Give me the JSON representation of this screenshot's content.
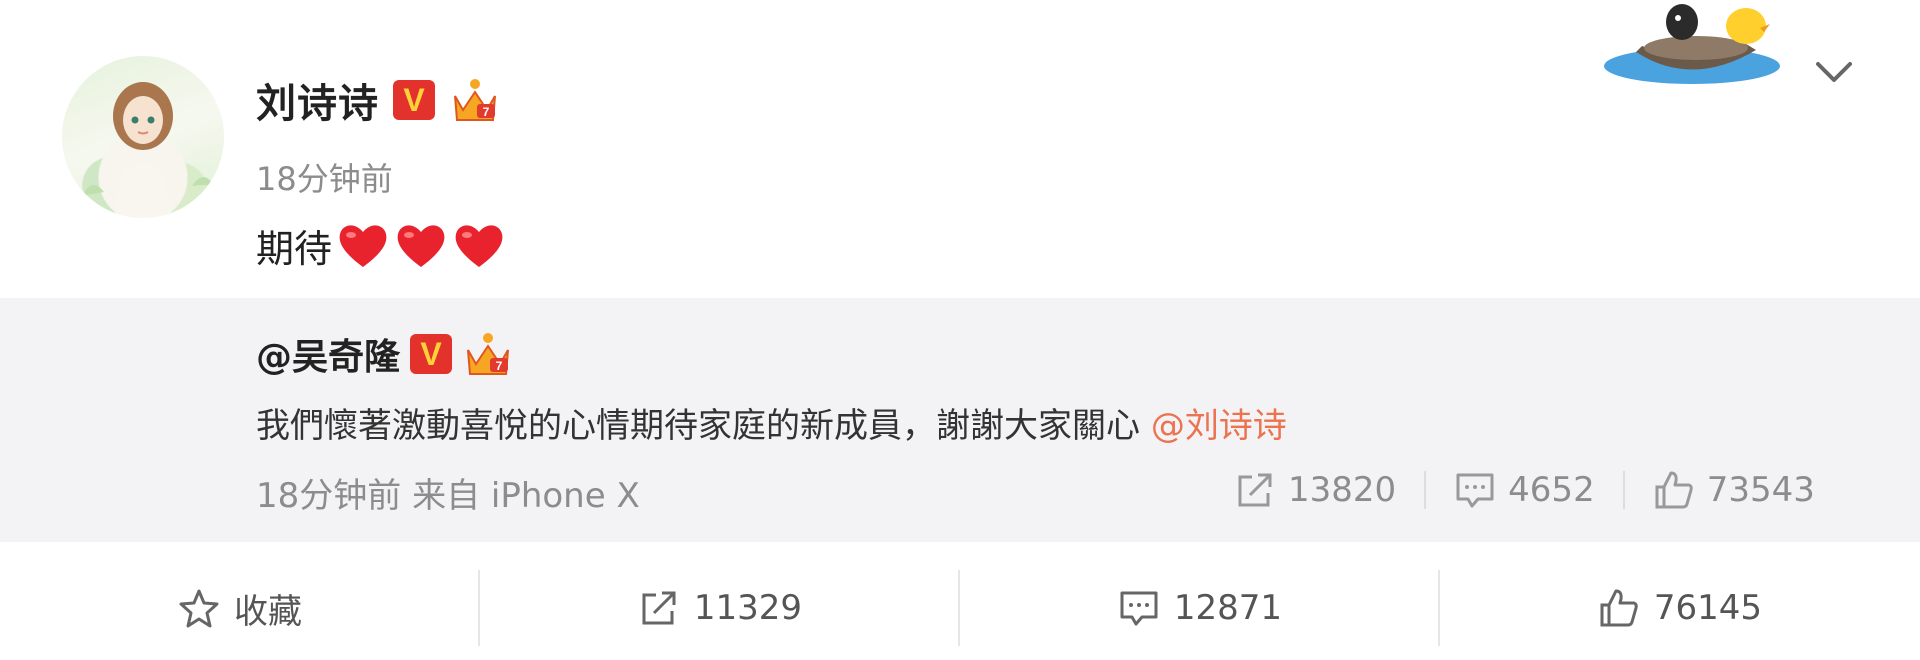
{
  "post": {
    "author": "刘诗诗",
    "verified_badge": "V",
    "time": "18分钟前",
    "text": "期待",
    "hearts": 3,
    "colors": {
      "heart": "#e8232e",
      "verified_bg": "#e2322b",
      "verified_fg": "#ffd23a",
      "mention": "#eb7350"
    }
  },
  "repost": {
    "author": "@吴奇隆",
    "verified_badge": "V",
    "text": "我們懷著激動喜悅的心情期待家庭的新成員，謝謝大家關心 ",
    "mention": "@刘诗诗",
    "meta": "18分钟前 来自 iPhone X",
    "shares": "13820",
    "comments": "4652",
    "likes": "73543"
  },
  "actions": {
    "favorite_label": "收藏",
    "shares": "11329",
    "comments": "12871",
    "likes": "76145"
  },
  "icons": [
    "chevron-down-icon",
    "share-icon",
    "comment-icon",
    "like-icon",
    "star-icon",
    "heart-icon",
    "crown-icon"
  ]
}
